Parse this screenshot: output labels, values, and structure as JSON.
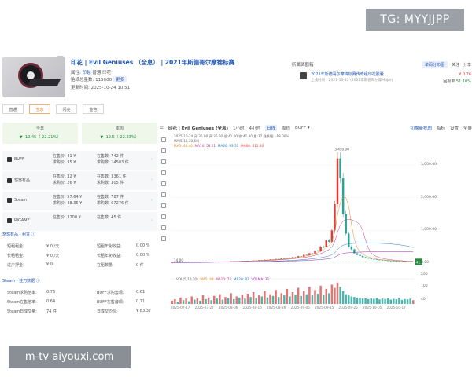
{
  "overlay": {
    "tg": "TG: MYYJJPP",
    "site": "m-tv-aiyouxi.com"
  },
  "item": {
    "title": "印花 | Evil Geniuses （全息） | 2021年斯德哥尔摩锦标赛",
    "type_label": "属性:",
    "type_value": "印越",
    "type_extra": "普通",
    "type_tag2": "印花",
    "supply_label": "贴纸总量数:",
    "supply_value": "115000",
    "supply_tag": "更多",
    "updated_label": "更新时间:",
    "updated_value": "2025-10-24 10:51"
  },
  "wear_tabs": [
    {
      "label": "普通",
      "active": false
    },
    {
      "label": "全息",
      "active": true
    },
    {
      "label": "闪亮",
      "active": false
    },
    {
      "label": "金色",
      "active": false
    }
  ],
  "related": {
    "title": "所属武器箱",
    "buttons": [
      "单码分布图",
      "关注",
      "分享"
    ],
    "item_title": "2021年斯德哥尔摩锦标赛传奇组印花胶囊",
    "item_sub": "上线时间：2021-10-22 (2021年斯德哥尔摩Major)",
    "price": "¥ 0.76",
    "ratio_label": "回报率",
    "ratio_value": "51.10%"
  },
  "compare": [
    {
      "label": "今日",
      "value": "▼ -19.45（-22.21%）"
    },
    {
      "label": "本周",
      "value": "▼ -19.5（-22.23%）"
    }
  ],
  "markets": [
    {
      "name": "BUFF",
      "sell_label": "在售价:",
      "sell": "41 ¥",
      "buy_label": "求购价:",
      "buy": "35 ¥",
      "sell_qty_label": "在售数:",
      "sell_qty": "742 件",
      "buy_qty_label": "求购数:",
      "buy_qty": "14503 件"
    },
    {
      "name": "悠悠有品",
      "sell_label": "在售价:",
      "sell": "32 ¥",
      "buy_label": "求购价:",
      "buy": "26 ¥",
      "sell_qty_label": "在售数:",
      "sell_qty": "3361 件",
      "buy_qty_label": "求购数:",
      "buy_qty": "305 件"
    },
    {
      "name": "Steam",
      "sell_label": "在售价:",
      "sell": "57.64 ¥",
      "buy_label": "求购价:",
      "buy": "48.35 ¥",
      "sell_qty_label": "在售数:",
      "sell_qty": "787 件",
      "buy_qty_label": "求购数:",
      "buy_qty": "67276 件"
    },
    {
      "name": "RIGAME",
      "sell_label": "在售价:",
      "sell": "3200 ¥",
      "buy_label": "",
      "buy": "",
      "sell_qty_label": "在售数:",
      "sell_qty": "45 件",
      "buy_qty_label": "",
      "buy_qty": ""
    }
  ],
  "rent": {
    "title": "悠悠有品 - 租赁 ⓘ",
    "rows": [
      [
        "短租租金:",
        "¥ 0 /天",
        "短租年化收益:",
        "0.00 %"
      ],
      [
        "长租租金:",
        "¥ 0 /天",
        "长租年化收益:",
        "0.00 %"
      ],
      [
        "过户押金:",
        "¥ 0",
        "在租数量:",
        "0 件"
      ]
    ]
  },
  "steam": {
    "title": "Steam - 挂刀数据 ⓘ",
    "rows": [
      [
        "Steam求购倍率:",
        "0.76",
        "BUFF求购套现:",
        "0.61"
      ],
      [
        "Steam在售倍率:",
        "0.64",
        "BUFF在售套现:",
        "0.71"
      ],
      [
        "Steam日成交量:",
        "74 件",
        "日成交均价:",
        "¥ 83.37"
      ]
    ]
  },
  "chart_toolbar": {
    "title": "印花 | Evil Geniuses (全息)",
    "intervals": [
      "1小时",
      "4小时",
      "日线",
      "周线"
    ],
    "active_interval": "日线",
    "platform": "BUFF ▾",
    "right": [
      "切换新视图",
      "指标",
      "设置",
      "全屏"
    ]
  },
  "chart_legend": {
    "line1": "2025-10-24  开:36.00  高:36.00  低:41.00  收:41.00  量:32  涨跌幅: -18.00%",
    "ma_label": "MA(5,10,30,60)",
    "ma5": "MA5: 44.40",
    "ma10": "MA10: 58.21",
    "ma30": "MA30: 93.51",
    "ma60": "MA60: 411.30"
  },
  "vol_legend": {
    "label": "VOL(5,10,20)",
    "ma5": "MA5: 48",
    "ma10": "MA10: 72",
    "ma20": "MA20: 82",
    "ma30": "VOLMA: 31"
  },
  "chart_data": {
    "type": "candlestick",
    "y_ticks": [
      "3,000.00",
      "2,000.00",
      "1,000.00",
      "0.00"
    ],
    "ylim": [
      0,
      3600
    ],
    "x_ticks": [
      "2025-07-17",
      "2025-07-27",
      "2025-08-06",
      "2025-08-16",
      "2025-08-26",
      "2025-09-05",
      "2025-09-15",
      "2025-09-25",
      "2025-10-05",
      "2025-10-17"
    ],
    "last_price_label": "41.00",
    "peak_label": "3,450.00",
    "low_label": "14.00",
    "vol_y_ticks": [
      "200",
      "100",
      "40"
    ],
    "closes": [
      20,
      22,
      21,
      24,
      23,
      26,
      25,
      28,
      27,
      30,
      29,
      33,
      32,
      36,
      35,
      40,
      38,
      44,
      42,
      48,
      47,
      55,
      52,
      60,
      58,
      66,
      63,
      72,
      70,
      80,
      78,
      90,
      88,
      100,
      96,
      112,
      108,
      125,
      120,
      140,
      135,
      160,
      152,
      180,
      175,
      210,
      200,
      250,
      240,
      300,
      290,
      380,
      360,
      500,
      480,
      700,
      650,
      1000,
      1800,
      3200,
      2600,
      1500,
      900,
      500,
      420,
      300,
      250,
      220,
      180,
      160,
      140,
      120,
      110,
      100,
      92,
      85,
      78,
      72,
      66,
      60,
      56,
      52,
      48,
      45,
      42,
      40,
      41
    ],
    "volumes": [
      30,
      45,
      20,
      60,
      35,
      50,
      25,
      70,
      40,
      55,
      30,
      80,
      45,
      60,
      35,
      75,
      50,
      90,
      40,
      65,
      55,
      100,
      45,
      70,
      60,
      85,
      50,
      95,
      65,
      110,
      55,
      80,
      70,
      120,
      60,
      90,
      75,
      130,
      65,
      100,
      80,
      140,
      70,
      110,
      85,
      150,
      75,
      120,
      90,
      160,
      80,
      130,
      95,
      170,
      85,
      140,
      100,
      180,
      150,
      200,
      160,
      120,
      90,
      80,
      70,
      65,
      60,
      55,
      50,
      58,
      45,
      52,
      48,
      55,
      42,
      50,
      46,
      53,
      40,
      48,
      44,
      51,
      38,
      46,
      42,
      49,
      35
    ]
  }
}
